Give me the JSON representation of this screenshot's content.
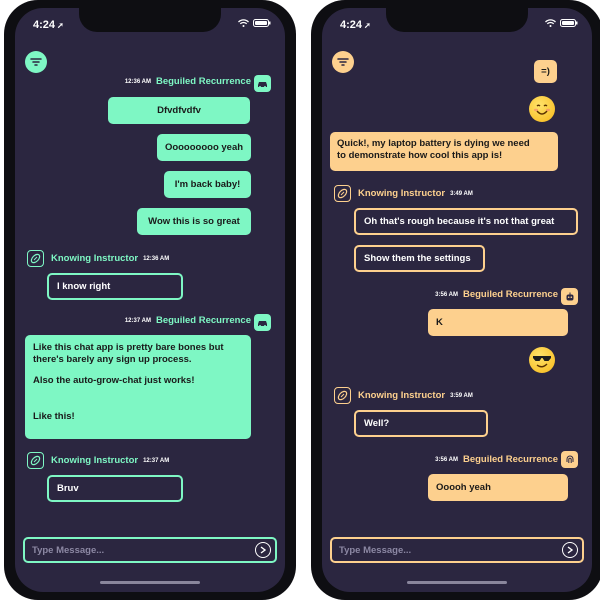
{
  "status": {
    "time": "4:24"
  },
  "input": {
    "placeholder": "Type Message..."
  },
  "left": {
    "h1": {
      "time": "12:36 AM",
      "name": "Beguiled Recurrence"
    },
    "m1": "Dfvdfvdfv",
    "m2": "Ooooooooo yeah",
    "m3": "I'm back baby!",
    "m4": "Wow this is so great",
    "h2": {
      "name": "Knowing Instructor",
      "time": "12:36 AM"
    },
    "m5": "I know right",
    "h3": {
      "time": "12:37 AM",
      "name": "Beguiled Recurrence"
    },
    "m6": {
      "l1": "Like this chat app is pretty bare bones but",
      "l2": "there's barely any sign up process.",
      "l3": "Also the auto-grow-chat just works!",
      "l4": "Like this!"
    },
    "h4": {
      "name": "Knowing Instructor",
      "time": "12:37 AM"
    },
    "m7": "Bruv"
  },
  "right": {
    "m1": "=)",
    "emoji1": "smiling-face",
    "m2": {
      "l1": "Quick!, my laptop battery is dying we need",
      "l2": "to demonstrate how cool this app is!"
    },
    "h1": {
      "name": "Knowing Instructor",
      "time": "3:49 AM"
    },
    "m3": "Oh that's rough because it's not that great",
    "m4": "Show them the settings",
    "h2": {
      "time": "3:56 AM",
      "name": "Beguiled Recurrence"
    },
    "m5": "K",
    "emoji2": "sunglasses-face",
    "h3": {
      "name": "Knowing Instructor",
      "time": "3:59 AM"
    },
    "m6": "Well?",
    "h4": {
      "time": "3:56 AM",
      "name": "Beguiled Recurrence"
    },
    "m7": "Ooooh yeah"
  },
  "colors": {
    "background": "#2b2640",
    "mint": "#7ef7c4",
    "peach": "#fdd08e"
  }
}
